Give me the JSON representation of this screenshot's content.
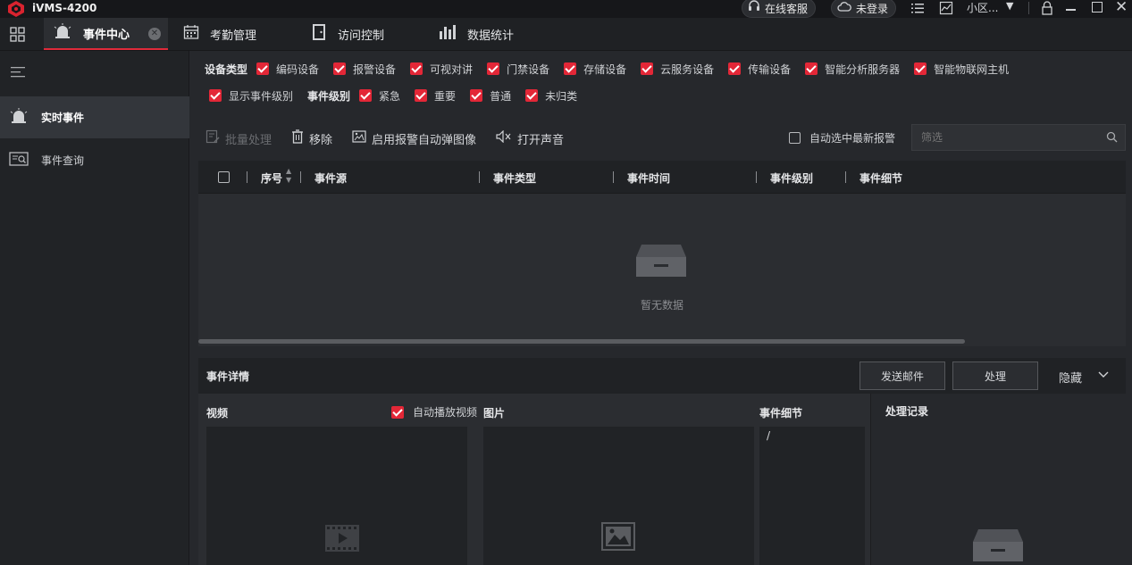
{
  "app": {
    "title": "iVMS-4200"
  },
  "titlebar": {
    "online_service": "在线客服",
    "login_status": "未登录",
    "community": "小区..."
  },
  "menu": {
    "tabs": [
      {
        "label": "事件中心",
        "icon": "alarm-light-icon",
        "active": true
      },
      {
        "label": "考勤管理",
        "icon": "calendar-icon"
      },
      {
        "label": "访问控制",
        "icon": "door-icon"
      },
      {
        "label": "数据统计",
        "icon": "bar-chart-icon"
      }
    ]
  },
  "sidebar": {
    "items": [
      {
        "label": "实时事件",
        "icon": "alarm-light-icon",
        "active": true
      },
      {
        "label": "事件查询",
        "icon": "search-event-icon"
      }
    ]
  },
  "filters": {
    "device_type_label": "设备类型",
    "device_types": [
      "编码设备",
      "报警设备",
      "可视对讲",
      "门禁设备",
      "存储设备",
      "云服务设备",
      "传输设备",
      "智能分析服务器",
      "智能物联网主机"
    ],
    "show_level": "显示事件级别",
    "level_label": "事件级别",
    "levels": [
      "紧急",
      "重要",
      "普通",
      "未归类"
    ]
  },
  "toolbar": {
    "batch": "批量处理",
    "remove": "移除",
    "popup": "启用报警自动弹图像",
    "sound": "打开声音",
    "auto_select": "自动选中最新报警",
    "filter_placeholder": "筛选"
  },
  "table": {
    "columns": [
      "序号",
      "事件源",
      "事件类型",
      "事件时间",
      "事件级别",
      "事件细节"
    ],
    "empty": "暂无数据"
  },
  "detail": {
    "title": "事件详情",
    "send_mail": "发送邮件",
    "handle": "处理",
    "hide": "隐藏",
    "video": "视频",
    "autoplay": "自动播放视频",
    "picture": "图片",
    "event_detail": "事件细节",
    "event_detail_value": "/",
    "record": "处理记录"
  },
  "colors": {
    "accent": "#e32737",
    "background": "#26282c"
  }
}
